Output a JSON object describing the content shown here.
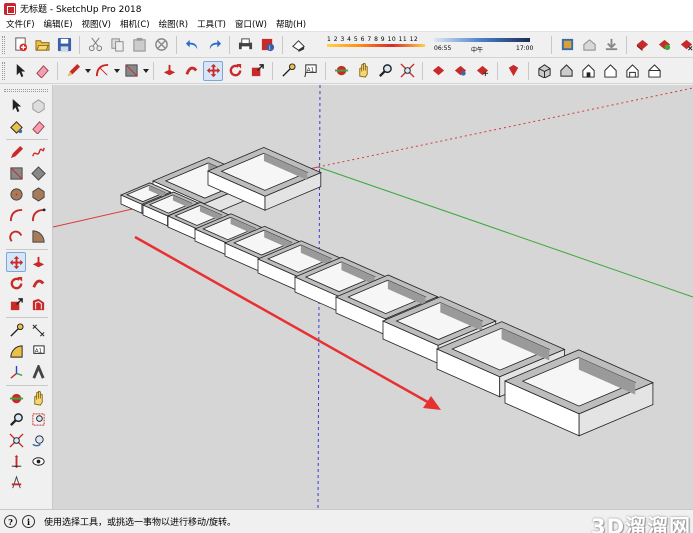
{
  "window": {
    "title": "无标题 - SketchUp Pro 2018"
  },
  "menu": [
    "文件(F)",
    "编辑(E)",
    "视图(V)",
    "相机(C)",
    "绘图(R)",
    "工具(T)",
    "窗口(W)",
    "帮助(H)"
  ],
  "shadows": {
    "months": "1 2 3 4 5 6 7 8 9 10 11 12",
    "time_start": "06:55",
    "noon": "中午",
    "time_end": "17:00"
  },
  "status": {
    "message": "使用选择工具，或挑选一事物以进行移动/旋转。"
  },
  "watermark": "3D溜溜网",
  "colors": {
    "axis_red": "#d83a3a",
    "axis_green": "#3aa83a",
    "axis_blue": "#3a3ad8",
    "viewport_bg": "#d6d6d6",
    "arrow": "#e83030",
    "active_tool": "#d6e6f7"
  },
  "tools": {
    "toolbar1": [
      "new-icon",
      "open-icon",
      "save-icon",
      "cut-icon",
      "copy-icon",
      "paste-icon",
      "erase-icon",
      "undo-icon",
      "redo-icon",
      "print-icon",
      "model-info-icon",
      "shadows-toggle-icon",
      "components-icon",
      "warehouse-icon",
      "download-icon",
      "extension-icon",
      "styles-icon",
      "layers-icon",
      "scenes-icon"
    ],
    "toolbar2": [
      "select-icon",
      "eraser-icon",
      "pencil-icon",
      "line-icon",
      "arc-icon",
      "shapes-icon",
      "pushpull-icon",
      "followme-icon",
      "move-icon",
      "rotate-icon",
      "scale-icon",
      "tape-icon",
      "text-icon",
      "orbit-icon",
      "pan-icon",
      "zoom-icon",
      "zoom-extents-icon",
      "iso-view-icon",
      "top-view-icon",
      "front-view-icon",
      "right-view-icon",
      "back-view-icon",
      "left-view-icon",
      "bottom-view-icon"
    ],
    "left": [
      "select-icon",
      "component-icon",
      "paint-icon",
      "eraser-icon",
      "line-icon",
      "freehand-icon",
      "rectangle-icon",
      "rotated-rect-icon",
      "circle-icon",
      "polygon-icon",
      "arc-icon",
      "arc2-icon",
      "arc3-icon",
      "pie-icon",
      "move-icon",
      "pushpull-icon",
      "rotate-icon",
      "followme-icon",
      "scale-icon",
      "offset-icon",
      "tape-icon",
      "dimension-icon",
      "protractor-icon",
      "text-icon",
      "axes-icon",
      "3dtext-icon",
      "orbit-icon",
      "pan-icon",
      "zoom-icon",
      "zoom-window-icon",
      "zoom-extents-icon",
      "prev-view-icon",
      "position-camera-icon",
      "walk-icon",
      "section-icon"
    ]
  }
}
